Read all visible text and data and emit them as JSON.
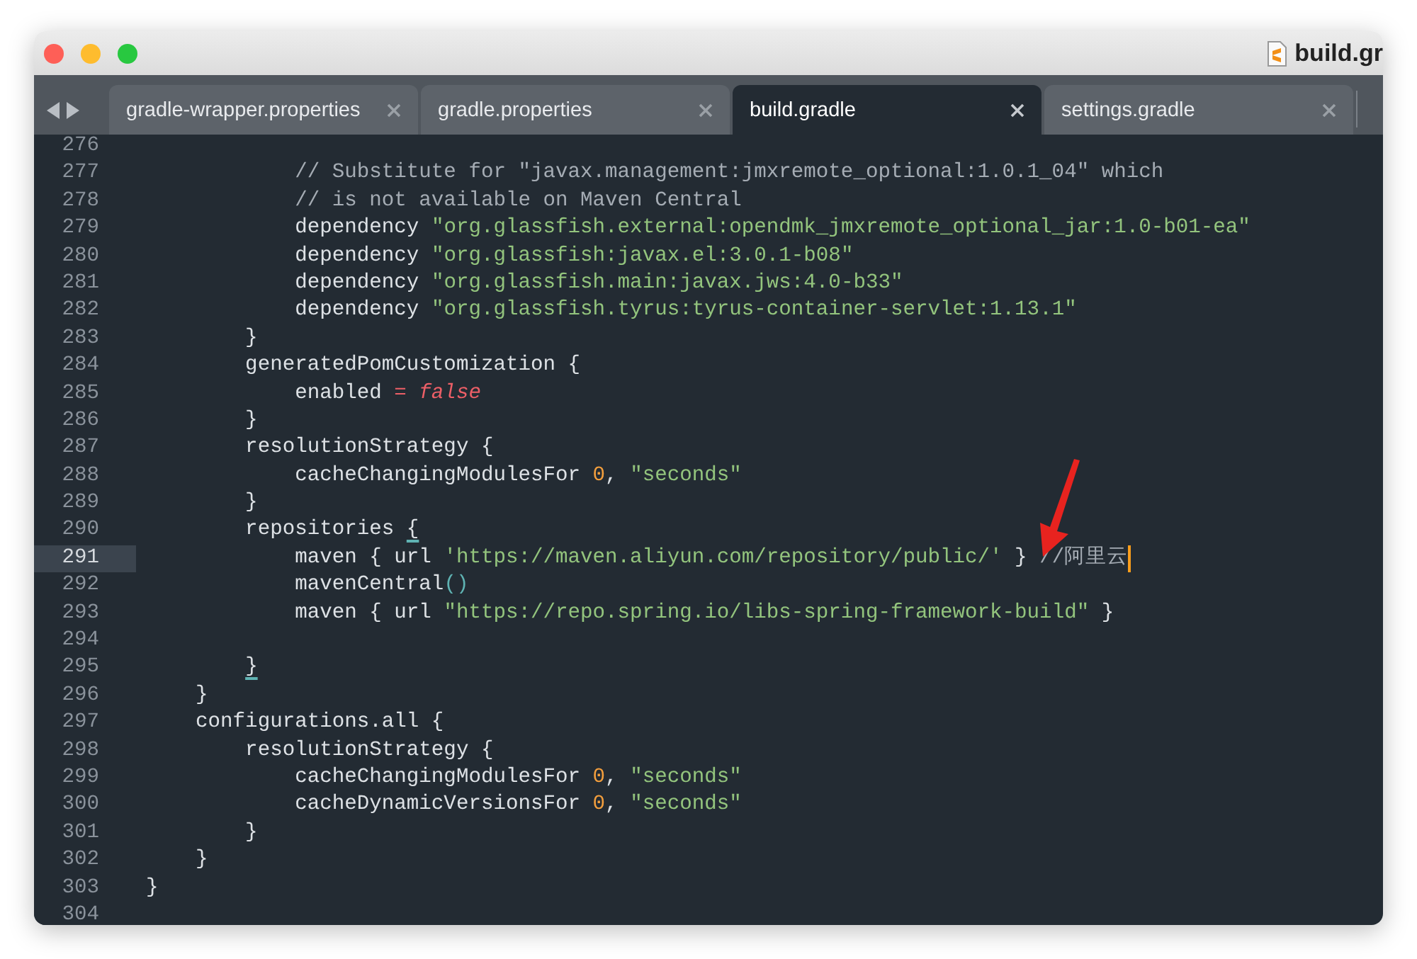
{
  "window": {
    "title": "build.gr"
  },
  "tabs": [
    {
      "label": "gradle-wrapper.properties",
      "selected": false
    },
    {
      "label": "gradle.properties",
      "selected": false
    },
    {
      "label": "build.gradle",
      "selected": true
    },
    {
      "label": "settings.gradle",
      "selected": false
    }
  ],
  "editor": {
    "lines": [
      {
        "number": "276",
        "current": false
      },
      {
        "number": "277",
        "current": false,
        "tokens": [
          {
            "kind": "comment",
            "text": "            // Substitute for \"javax.management:jmxremote_optional:1.0.1_04\" which"
          }
        ]
      },
      {
        "number": "278",
        "current": false,
        "tokens": [
          {
            "kind": "comment",
            "text": "            // is not available on Maven Central"
          }
        ]
      },
      {
        "number": "279",
        "current": false,
        "tokens": [
          {
            "kind": "plain",
            "text": "            dependency "
          },
          {
            "kind": "string",
            "text": "\"org.glassfish.external:opendmk_jmxremote_optional_jar:1.0-b01-ea\""
          }
        ]
      },
      {
        "number": "280",
        "current": false,
        "tokens": [
          {
            "kind": "plain",
            "text": "            dependency "
          },
          {
            "kind": "string",
            "text": "\"org.glassfish:javax.el:3.0.1-b08\""
          }
        ]
      },
      {
        "number": "281",
        "current": false,
        "tokens": [
          {
            "kind": "plain",
            "text": "            dependency "
          },
          {
            "kind": "string",
            "text": "\"org.glassfish.main:javax.jws:4.0-b33\""
          }
        ]
      },
      {
        "number": "282",
        "current": false,
        "tokens": [
          {
            "kind": "plain",
            "text": "            dependency "
          },
          {
            "kind": "string",
            "text": "\"org.glassfish.tyrus:tyrus-container-servlet:1.13.1\""
          }
        ]
      },
      {
        "number": "283",
        "current": false,
        "tokens": [
          {
            "kind": "plain",
            "text": "        }"
          }
        ]
      },
      {
        "number": "284",
        "current": false,
        "tokens": [
          {
            "kind": "plain",
            "text": "        generatedPomCustomization {"
          }
        ]
      },
      {
        "number": "285",
        "current": false,
        "tokens": [
          {
            "kind": "plain",
            "text": "            enabled "
          },
          {
            "kind": "operator",
            "text": "= "
          },
          {
            "kind": "keyword",
            "text": "false"
          }
        ]
      },
      {
        "number": "286",
        "current": false,
        "tokens": [
          {
            "kind": "plain",
            "text": "        }"
          }
        ]
      },
      {
        "number": "287",
        "current": false,
        "tokens": [
          {
            "kind": "plain",
            "text": "        resolutionStrategy {"
          }
        ]
      },
      {
        "number": "288",
        "current": false,
        "tokens": [
          {
            "kind": "plain",
            "text": "            cacheChangingModulesFor "
          },
          {
            "kind": "number",
            "text": "0"
          },
          {
            "kind": "plain",
            "text": ", "
          },
          {
            "kind": "string",
            "text": "\"seconds\""
          }
        ]
      },
      {
        "number": "289",
        "current": false,
        "tokens": [
          {
            "kind": "plain",
            "text": "        }"
          }
        ]
      },
      {
        "number": "290",
        "current": false,
        "tokens": [
          {
            "kind": "plain",
            "text": "        repositories "
          },
          {
            "kind": "match",
            "text": "{"
          }
        ]
      },
      {
        "number": "291",
        "current": true,
        "tokens": [
          {
            "kind": "plain",
            "text": "            maven { url "
          },
          {
            "kind": "string",
            "text": "'https://maven.aliyun.com/repository/public/'"
          },
          {
            "kind": "plain",
            "text": " } "
          },
          {
            "kind": "comment",
            "text": "//阿里云"
          }
        ]
      },
      {
        "number": "292",
        "current": false,
        "tokens": [
          {
            "kind": "plain",
            "text": "            mavenCentral"
          },
          {
            "kind": "paren",
            "text": "()"
          }
        ]
      },
      {
        "number": "293",
        "current": false,
        "tokens": [
          {
            "kind": "plain",
            "text": "            maven { url "
          },
          {
            "kind": "string",
            "text": "\"https://repo.spring.io/libs-spring-framework-build\""
          },
          {
            "kind": "plain",
            "text": " }"
          }
        ]
      },
      {
        "number": "294",
        "current": false
      },
      {
        "number": "295",
        "current": false,
        "tokens": [
          {
            "kind": "match",
            "text": "        }"
          }
        ]
      },
      {
        "number": "296",
        "current": false,
        "tokens": [
          {
            "kind": "plain",
            "text": "    }"
          }
        ]
      },
      {
        "number": "297",
        "current": false,
        "tokens": [
          {
            "kind": "plain",
            "text": "    configurations.all {"
          }
        ]
      },
      {
        "number": "298",
        "current": false,
        "tokens": [
          {
            "kind": "plain",
            "text": "        resolutionStrategy {"
          }
        ]
      },
      {
        "number": "299",
        "current": false,
        "tokens": [
          {
            "kind": "plain",
            "text": "            cacheChangingModulesFor "
          },
          {
            "kind": "number",
            "text": "0"
          },
          {
            "kind": "plain",
            "text": ", "
          },
          {
            "kind": "string",
            "text": "\"seconds\""
          }
        ]
      },
      {
        "number": "300",
        "current": false,
        "tokens": [
          {
            "kind": "plain",
            "text": "            cacheDynamicVersionsFor "
          },
          {
            "kind": "number",
            "text": "0"
          },
          {
            "kind": "plain",
            "text": ", "
          },
          {
            "kind": "string",
            "text": "\"seconds\""
          }
        ]
      },
      {
        "number": "301",
        "current": false,
        "tokens": [
          {
            "kind": "plain",
            "text": "        }"
          }
        ]
      },
      {
        "number": "302",
        "current": false,
        "tokens": [
          {
            "kind": "plain",
            "text": "    }"
          }
        ]
      },
      {
        "number": "303",
        "current": false,
        "tokens": [
          {
            "kind": "plain",
            "text": "}"
          }
        ]
      },
      {
        "number": "304",
        "current": false
      }
    ]
  }
}
